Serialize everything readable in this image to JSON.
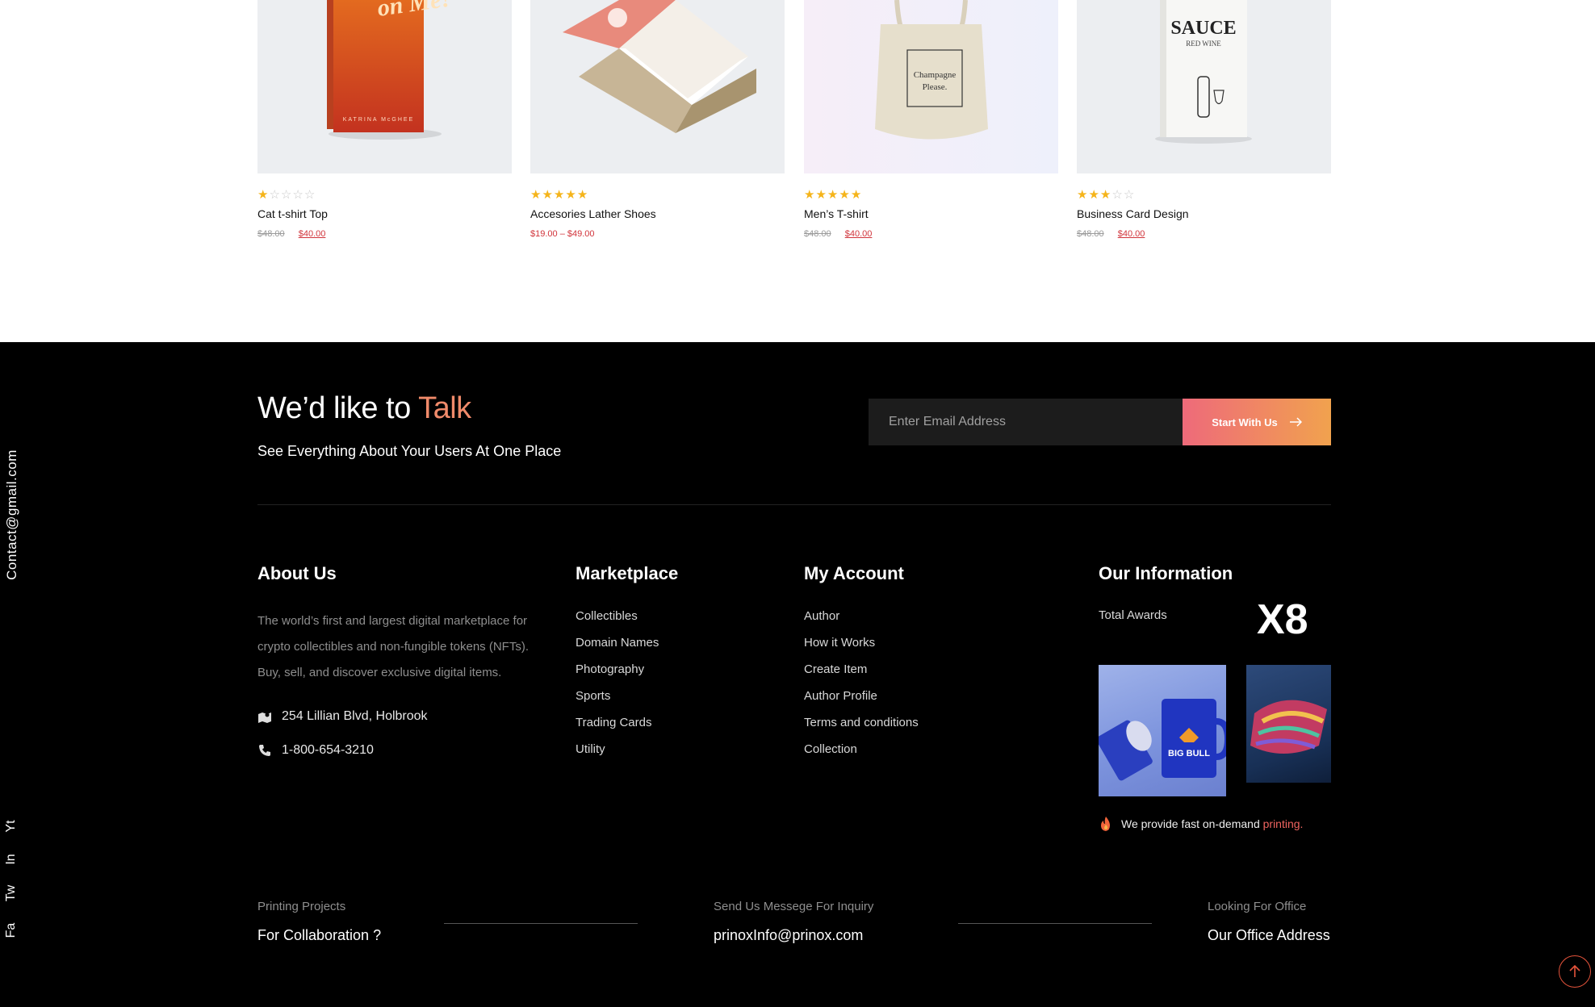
{
  "products": [
    {
      "name": "Cat t-shirt Top",
      "rating": 1,
      "old_price": "$48.00",
      "new_price": "$40.00",
      "image_text": "on Me!",
      "image_author": "KATRINA McGHEE"
    },
    {
      "name": "Accesories Lather Shoes",
      "rating": 5,
      "price_range": "$19.00 – $49.00"
    },
    {
      "name": "Men’s T-shirt",
      "rating": 5,
      "old_price": "$48.00",
      "new_price": "$40.00",
      "bag_text_1": "Champagne",
      "bag_text_2": "Please."
    },
    {
      "name": "Business Card Design",
      "rating": 3,
      "old_price": "$48.00",
      "new_price": "$40.00",
      "bottle_title": "SAUCE",
      "bottle_sub": "RED WINE"
    }
  ],
  "side": {
    "email": "Contact@gmail.com",
    "social": [
      "Yt",
      "In",
      "Tw",
      "Fa"
    ]
  },
  "talk": {
    "title_main": "We’d like to ",
    "title_highlight": "Talk",
    "subtitle": "See Everything About Your Users At One Place",
    "email_placeholder": "Enter Email Address",
    "button_label": "Start With Us"
  },
  "about": {
    "title": "About Us",
    "text": "The world’s first and largest digital marketplace for crypto collectibles and non-fungible tokens (NFTs). Buy, sell, and discover exclusive digital items.",
    "address": "254 Lillian Blvd, Holbrook",
    "phone": "1-800-654-3210"
  },
  "marketplace": {
    "title": "Marketplace",
    "links": [
      "Collectibles",
      "Domain Names",
      "Photography",
      "Sports",
      "Trading Cards",
      "Utility"
    ]
  },
  "account": {
    "title": "My Account",
    "links": [
      "Author",
      "How it Works",
      "Create Item",
      "Author Profile",
      "Terms and conditions",
      "Collection"
    ]
  },
  "info": {
    "title": "Our Information",
    "awards_label": "Total Awards",
    "awards_value": "X8",
    "mug_text": "BIG BULL",
    "printing_text": "We provide fast on-demand ",
    "printing_accent": "printing."
  },
  "bottom": [
    {
      "label": "Printing Projects",
      "value": "For Collaboration ?"
    },
    {
      "label": "Send Us Messege For Inquiry",
      "value": "prinoxInfo@prinox.com"
    },
    {
      "label": "Looking For Office",
      "value": "Our Office Address"
    }
  ],
  "colors": {
    "accent": "#f08a6a",
    "price_red": "#d1343b",
    "star": "#f5b41a",
    "footer_bg": "#000000"
  }
}
